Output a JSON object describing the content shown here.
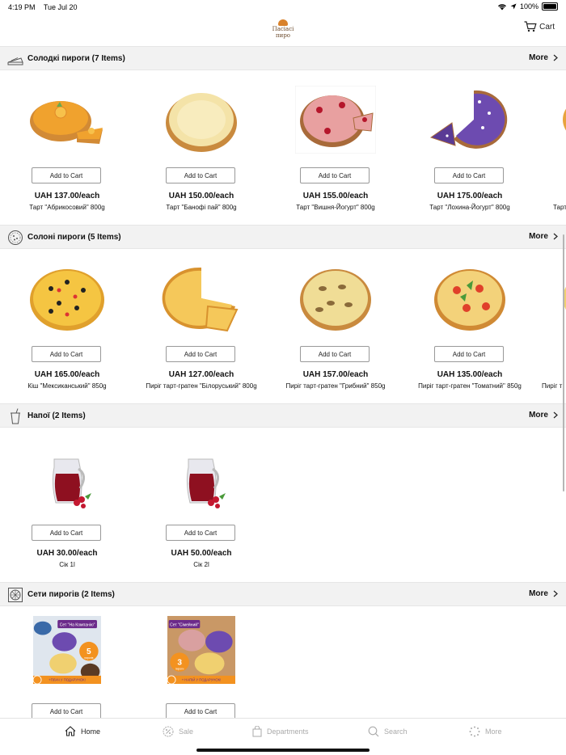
{
  "status_bar": {
    "time": "4:19 PM",
    "date": "Tue Jul 20",
    "battery": "100%",
    "battery_level": 1.0
  },
  "header": {
    "logo_lines": [
      "Пасіасі",
      "пиро"
    ],
    "cart_label": "Cart"
  },
  "sections": [
    {
      "title": "Солодкі пироги (7 Items)",
      "icon": "cake-slice-icon",
      "more_label": "More",
      "products": [
        {
          "name": "Тарт \"Абрикосовий\" 800g",
          "price": "UAH 137.00/each",
          "button": "Add to Cart"
        },
        {
          "name": "Тарт \"Банофі пай\" 800g",
          "price": "UAH 150.00/each",
          "button": "Add to Cart"
        },
        {
          "name": "Тарт \"Вишня-Йогурт\" 800g",
          "price": "UAH 155.00/each",
          "button": "Add to Cart"
        },
        {
          "name": "Тарт \"Лохина-Йогурт\" 800g",
          "price": "UAH 175.00/each",
          "button": "Add to Cart"
        },
        {
          "name": "Тарт",
          "price": "",
          "button": ""
        }
      ]
    },
    {
      "title": "Солоні пироги (5 Items)",
      "icon": "pizza-icon",
      "more_label": "More",
      "products": [
        {
          "name": "Кіш \"Мексиканський\" 850g",
          "price": "UAH 165.00/each",
          "button": "Add to Cart"
        },
        {
          "name": "Пиріг тарт-гратен \"Білоруський\" 800g",
          "price": "UAH 127.00/each",
          "button": "Add to Cart"
        },
        {
          "name": "Пиріг тарт-гратен \"Грибний\" 850g",
          "price": "UAH 157.00/each",
          "button": "Add to Cart"
        },
        {
          "name": "Пиріг тарт-гратен \"Томатний\" 850g",
          "price": "UAH 135.00/each",
          "button": "Add to Cart"
        },
        {
          "name": "Пиріг т",
          "price": "",
          "button": ""
        }
      ]
    },
    {
      "title": "Напої (2 Items)",
      "icon": "drink-cup-icon",
      "more_label": "More",
      "products": [
        {
          "name": "Сік 1l",
          "price": "UAH 30.00/each",
          "button": "Add to Cart"
        },
        {
          "name": "Сік 2l",
          "price": "UAH 50.00/each",
          "button": "Add to Cart"
        }
      ]
    },
    {
      "title": "Сети пирогів (2 Items)",
      "icon": "pie-set-icon",
      "more_label": "More",
      "products": [
        {
          "name": "",
          "price": "",
          "button": "Add to Cart",
          "banner_title": "Сет \"На Компанію\"",
          "banner_count": "5",
          "banner_sub": "пирогів",
          "banner_promo": "+ПЛАЧ У ПОДАРУНОК!"
        },
        {
          "name": "",
          "price": "",
          "button": "Add to Cart",
          "banner_title": "Сет \"Сімейний\"",
          "banner_count": "3",
          "banner_sub": "пироги",
          "banner_promo": "+ НАПІЙ У ПОДАРУНОК!"
        }
      ]
    }
  ],
  "tab_bar": [
    {
      "label": "Home",
      "icon": "home-icon",
      "active": true
    },
    {
      "label": "Sale",
      "icon": "sale-icon",
      "active": false
    },
    {
      "label": "Departments",
      "icon": "shopping-bag-icon",
      "active": false
    },
    {
      "label": "Search",
      "icon": "search-icon",
      "active": false
    },
    {
      "label": "More",
      "icon": "more-dots-icon",
      "active": false
    }
  ],
  "colors": {
    "section_bg": "#f2f2f2",
    "pastry": "#e8a33d",
    "crust": "#d28a35",
    "juice": "#8e1020",
    "banner_purple": "#6b2a8a",
    "banner_orange": "#f39220"
  }
}
